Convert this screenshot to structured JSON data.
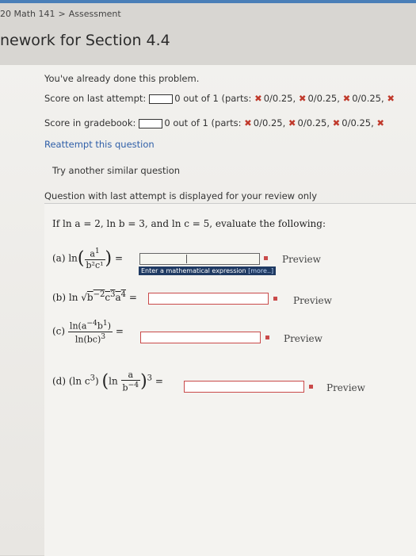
{
  "breadcrumb": {
    "course": "20 Math 141",
    "separator": ">",
    "page": "Assessment"
  },
  "title": "nework for Section 4.4",
  "notice": "You've already done this problem.",
  "score_last": {
    "label": "Score on last attempt:",
    "value": "0 out of 1 (parts:",
    "parts": [
      "0/0.25,",
      "0/0.25,",
      "0/0.25,"
    ]
  },
  "score_gradebook": {
    "label": "Score in gradebook:",
    "value": "0 out of 1 (parts:",
    "parts": [
      "0/0.25,",
      "0/0.25,",
      "0/0.25,"
    ]
  },
  "links": {
    "reattempt": "Reattempt this question",
    "similar": "Try another similar question"
  },
  "question_note": "Question with last attempt is displayed for your review only",
  "problem_statement": "If ln a = 2, ln b = 3, and ln c = 5, evaluate the following:",
  "parts": {
    "a": {
      "label": "(a) ln",
      "num": "a",
      "num_exp": "1",
      "den": "b²c¹",
      "eq": "="
    },
    "b": {
      "label": "(b) ln",
      "radicand": "b",
      "exp1": "−2",
      "mid": "c",
      "exp2": "3",
      "tail": "a",
      "exp3": "4",
      "eq": "="
    },
    "c": {
      "label": "(c)",
      "num": "ln(a",
      "num_exp": "−4",
      "num_b": "b",
      "num_b_exp": "1",
      "den": "ln(bc)",
      "den_exp": "3",
      "eq": "="
    },
    "d": {
      "label": "(d) (ln c",
      "exp": "3",
      "inner": "ln",
      "num": "a",
      "den": "b",
      "den_exp": "−4",
      "outer_exp": "3",
      "eq": "="
    }
  },
  "preview_label": "Preview",
  "tooltip": {
    "text": "Enter a mathematical expression",
    "more": "[more..]"
  },
  "colors": {
    "error": "#c94a4a",
    "xmark": "#c0392b",
    "link": "#2f5fa8",
    "tooltip_bg": "#1f3a63"
  },
  "icons": [
    "x-mark-icon",
    "error-square-icon"
  ]
}
